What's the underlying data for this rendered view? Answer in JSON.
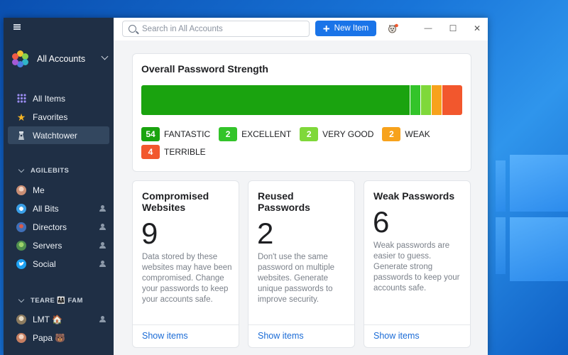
{
  "sidebar": {
    "account_switcher": "All Accounts",
    "nav": [
      {
        "label": "All Items",
        "icon": "grid-icon"
      },
      {
        "label": "Favorites",
        "icon": "star-icon"
      },
      {
        "label": "Watchtower",
        "icon": "watchtower-icon"
      }
    ],
    "sections": [
      {
        "title": "AGILEBITS",
        "vaults": [
          {
            "label": "Me",
            "shared": false,
            "color": "#c98d74"
          },
          {
            "label": "All Bits",
            "shared": true,
            "color": "#3aa0e8"
          },
          {
            "label": "Directors",
            "shared": true,
            "color": "#3f6fb8"
          },
          {
            "label": "Servers",
            "shared": true,
            "color": "#6aa86a"
          },
          {
            "label": "Social",
            "shared": true,
            "color": "#1da1f2"
          }
        ]
      },
      {
        "title": "TEARE 👨‍👩‍👧 FAM",
        "vaults": [
          {
            "label": "LMT 🏠",
            "shared": true,
            "color": "#b5a48a"
          },
          {
            "label": "Papa 🐻",
            "shared": false,
            "color": "#c67f62"
          }
        ]
      }
    ]
  },
  "toolbar": {
    "search_placeholder": "Search in All Accounts",
    "new_item_label": "New Item",
    "minimize": "—",
    "maximize": "☐",
    "close": "✕"
  },
  "strength": {
    "title": "Overall Password Strength",
    "levels": [
      {
        "count": "54",
        "label": "FANTASTIC",
        "color": "#1aa30f",
        "value": 54
      },
      {
        "count": "2",
        "label": "EXCELLENT",
        "color": "#33c42a",
        "value": 2
      },
      {
        "count": "2",
        "label": "VERY GOOD",
        "color": "#7fd83a",
        "value": 2
      },
      {
        "count": "2",
        "label": "WEAK",
        "color": "#f7a21c",
        "value": 2
      },
      {
        "count": "4",
        "label": "TERRIBLE",
        "color": "#f2572d",
        "value": 4
      }
    ]
  },
  "cards": [
    {
      "title": "Compromised Websites",
      "number": "9",
      "description": "Data stored by these websites may have been compromised. Change your passwords to keep your accounts safe.",
      "link": "Show items"
    },
    {
      "title": "Reused Passwords",
      "number": "2",
      "description": "Don't use the same password on multiple websites. Generate unique passwords to improve security.",
      "link": "Show items"
    },
    {
      "title": "Weak Passwords",
      "number": "6",
      "description": "Weak passwords are easier to guess. Generate strong passwords to keep your accounts safe.",
      "link": "Show items"
    }
  ]
}
